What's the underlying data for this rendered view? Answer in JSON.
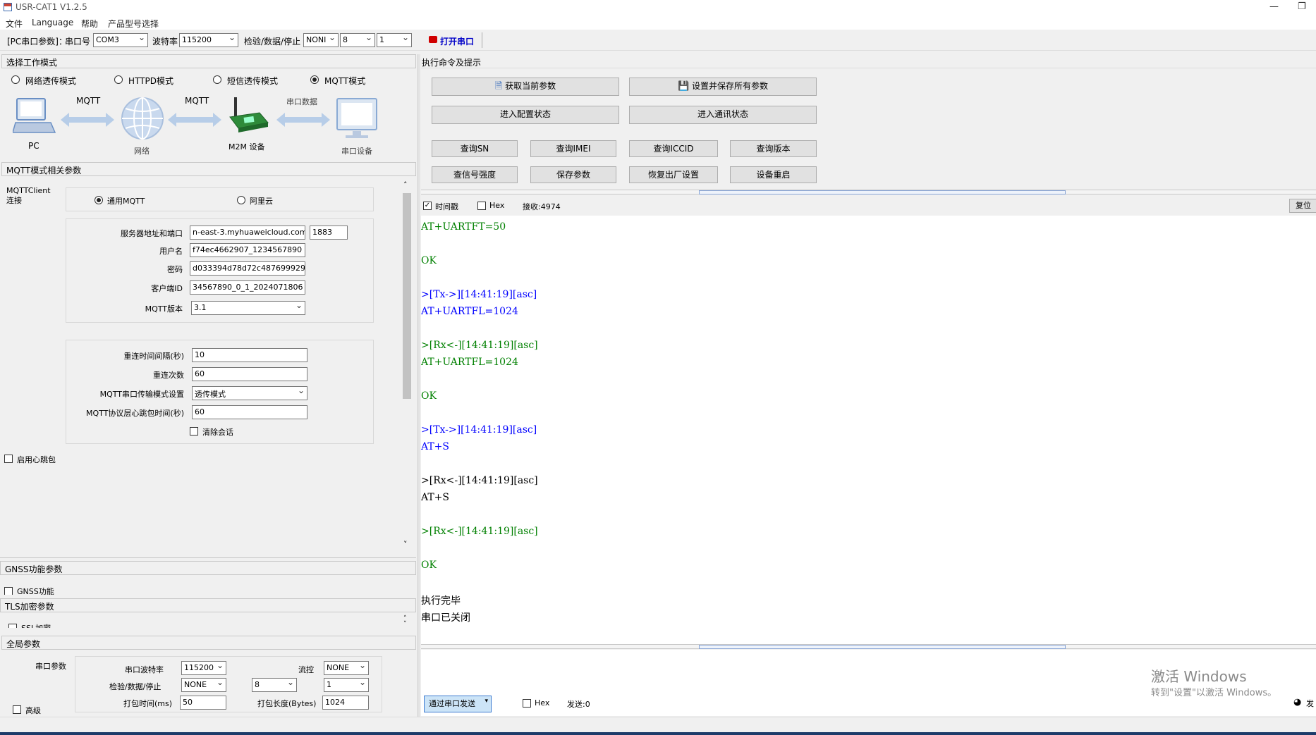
{
  "window": {
    "title": "USR-CAT1 V1.2.5",
    "minimize_glyph": "—",
    "restore_glyph": "❐"
  },
  "menu": [
    "文件",
    "Language",
    "帮助",
    "产品型号选择"
  ],
  "toolbar": {
    "pc_params_label": "[PC串口参数]：",
    "port_label": "串口号",
    "port_value": "COM3",
    "baud_label": "波特率",
    "baud_value": "115200",
    "check_label": "检验/数据/停止",
    "parity_value": "NONI",
    "databits_value": "8",
    "stopbits_value": "1",
    "open_port_label": "打开串口",
    "open_port_icon_color": "#d00000"
  },
  "work_mode": {
    "header": "选择工作模式",
    "modes": [
      {
        "label": "网络透传模式",
        "selected": false
      },
      {
        "label": "HTTPD模式",
        "selected": false
      },
      {
        "label": "短信透传模式",
        "selected": false
      },
      {
        "label": "MQTT模式",
        "selected": true
      }
    ],
    "diagram": {
      "pc_label": "PC",
      "link1_label": "MQTT",
      "network_label": "网络",
      "link2_label": "MQTT",
      "device_label": "M2M 设备",
      "link3_label": "串口数据",
      "serial_device_label": "串口设备"
    }
  },
  "mqtt": {
    "header": "MQTT模式相关参数",
    "client_label": "MQTTClient\n连接",
    "type_options": [
      {
        "label": "通用MQTT",
        "selected": true
      },
      {
        "label": "阿里云",
        "selected": false
      }
    ],
    "server_label": "服务器地址和端口",
    "server_value": "n-east-3.myhuaweicloud.com",
    "port_value": "1883",
    "username_label": "用户名",
    "username_value": "f74ec4662907_1234567890",
    "password_label": "密码",
    "password_value": "d033394d78d72c487699929",
    "client_id_label": "客户端ID",
    "client_id_value": "34567890_0_1_2024071806",
    "version_label": "MQTT版本",
    "version_value": "3.1",
    "reconnect_interval_label": "重连时间间隔(秒)",
    "reconnect_interval_value": "10",
    "reconnect_count_label": "重连次数",
    "reconnect_count_value": "60",
    "transfer_mode_label": "MQTT串口传输模式设置",
    "transfer_mode_value": "透传模式",
    "keepalive_label": "MQTT协议层心跳包时间(秒)",
    "keepalive_value": "60",
    "clear_session_label": "清除会话",
    "heartbeat_label": "启用心跳包"
  },
  "gnss": {
    "header": "GNSS功能参数",
    "enable_label": "GNSS功能"
  },
  "tls": {
    "header": "TLS加密参数",
    "enable_label": "SSL加密"
  },
  "global": {
    "header": "全局参数",
    "serial_params_label": "串口参数",
    "baud_label": "串口波特率",
    "baud_value": "115200",
    "flow_label": "流控",
    "flow_value": "NONE",
    "check_label": "检验/数据/停止",
    "parity_value": "NONE",
    "databits_value": "8",
    "stopbits_value": "1",
    "pack_time_label": "打包时间(ms)",
    "pack_time_value": "50",
    "pack_len_label": "打包长度(Bytes)",
    "pack_len_value": "1024",
    "advanced_label": "高级"
  },
  "commands": {
    "header": "执行命令及提示",
    "get_params": "获取当前参数",
    "save_all": "设置并保存所有参数",
    "enter_config": "进入配置状态",
    "enter_comm": "进入通讯状态",
    "query_sn": "查询SN",
    "query_imei": "查询IMEI",
    "query_iccid": "查询ICCID",
    "query_version": "查询版本",
    "query_signal": "查信号强度",
    "save_params": "保存参数",
    "factory_reset": "恢复出厂设置",
    "device_restart": "设备重启"
  },
  "log_options": {
    "timestamp_label": "时间戳",
    "timestamp_checked": true,
    "hex_label": "Hex",
    "received_label": "接收:4974",
    "reset_label": "复位"
  },
  "log": [
    {
      "text": "AT+UARTFT=50",
      "color": "#008000"
    },
    {
      "text": "OK",
      "color": "#008000"
    },
    {
      "text": ">[Tx->][14:41:19][asc]",
      "color": "#0000ff"
    },
    {
      "text": "AT+UARTFL=1024",
      "color": "#0000ff"
    },
    {
      "text": ">[Rx<-][14:41:19][asc]",
      "color": "#008000"
    },
    {
      "text": "AT+UARTFL=1024",
      "color": "#008000"
    },
    {
      "text": "OK",
      "color": "#008000"
    },
    {
      "text": ">[Tx->][14:41:19][asc]",
      "color": "#0000ff"
    },
    {
      "text": "AT+S",
      "color": "#0000ff"
    },
    {
      "text": ">[Rx<-][14:41:19][asc]",
      "color": "#000000"
    },
    {
      "text": "AT+S",
      "color": "#000000"
    },
    {
      "text": ">[Rx<-][14:41:19][asc]",
      "color": "#008000"
    },
    {
      "text": "OK",
      "color": "#008000"
    },
    {
      "text": "执行完毕",
      "color": "#000000"
    },
    {
      "text": "串口已关闭",
      "color": "#000000"
    }
  ],
  "send": {
    "mode_label": "通过串口发送",
    "hex_label": "Hex",
    "sent_label": "发送:0",
    "send_label": "发"
  },
  "watermark": {
    "line1": "激活 Windows",
    "line2": "转到\"设置\"以激活 Windows。"
  }
}
